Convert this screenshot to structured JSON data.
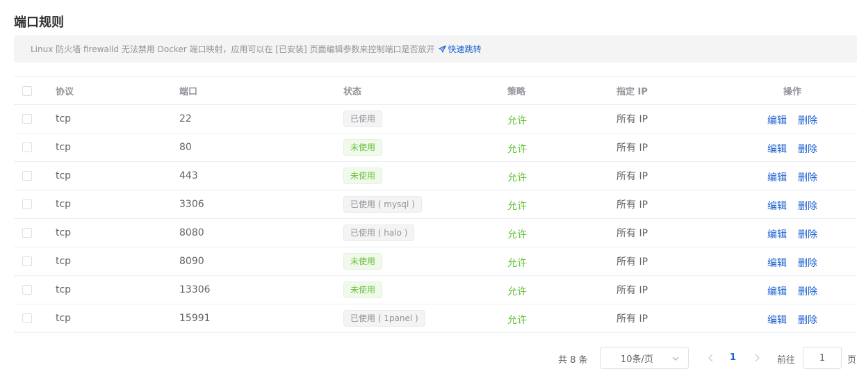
{
  "page": {
    "title": "端口规则"
  },
  "notice": {
    "text": "Linux 防火墙 firewalld 无法禁用 Docker 端口映射，应用可以在 [已安装] 页面编辑参数来控制端口是否放开",
    "link_label": "快速跳转",
    "link_icon": "send-icon"
  },
  "table": {
    "headers": {
      "protocol": "协议",
      "port": "端口",
      "status": "状态",
      "strategy": "策略",
      "address": "指定 IP",
      "operations": "操作"
    },
    "rows": [
      {
        "protocol": "tcp",
        "port": "22",
        "status": "已使用",
        "status_type": "used",
        "strategy": "允许",
        "address": "所有 IP",
        "edit": "编辑",
        "delete": "删除"
      },
      {
        "protocol": "tcp",
        "port": "80",
        "status": "未使用",
        "status_type": "free",
        "strategy": "允许",
        "address": "所有 IP",
        "edit": "编辑",
        "delete": "删除"
      },
      {
        "protocol": "tcp",
        "port": "443",
        "status": "未使用",
        "status_type": "free",
        "strategy": "允许",
        "address": "所有 IP",
        "edit": "编辑",
        "delete": "删除"
      },
      {
        "protocol": "tcp",
        "port": "3306",
        "status": "已使用 ( mysql )",
        "status_type": "used",
        "strategy": "允许",
        "address": "所有 IP",
        "edit": "编辑",
        "delete": "删除"
      },
      {
        "protocol": "tcp",
        "port": "8080",
        "status": "已使用 ( halo )",
        "status_type": "used",
        "strategy": "允许",
        "address": "所有 IP",
        "edit": "编辑",
        "delete": "删除"
      },
      {
        "protocol": "tcp",
        "port": "8090",
        "status": "未使用",
        "status_type": "free",
        "strategy": "允许",
        "address": "所有 IP",
        "edit": "编辑",
        "delete": "删除"
      },
      {
        "protocol": "tcp",
        "port": "13306",
        "status": "未使用",
        "status_type": "free",
        "strategy": "允许",
        "address": "所有 IP",
        "edit": "编辑",
        "delete": "删除"
      },
      {
        "protocol": "tcp",
        "port": "15991",
        "status": "已使用 ( 1panel )",
        "status_type": "used",
        "strategy": "允许",
        "address": "所有 IP",
        "edit": "编辑",
        "delete": "删除"
      }
    ]
  },
  "pagination": {
    "total_text": "共 8 条",
    "page_size": "10条/页",
    "current_page": "1",
    "goto_label": "前往",
    "goto_value": "1",
    "page_suffix": "页"
  },
  "colors": {
    "primary": "#1a5fd1",
    "success": "#67c23a",
    "muted": "#909399"
  }
}
